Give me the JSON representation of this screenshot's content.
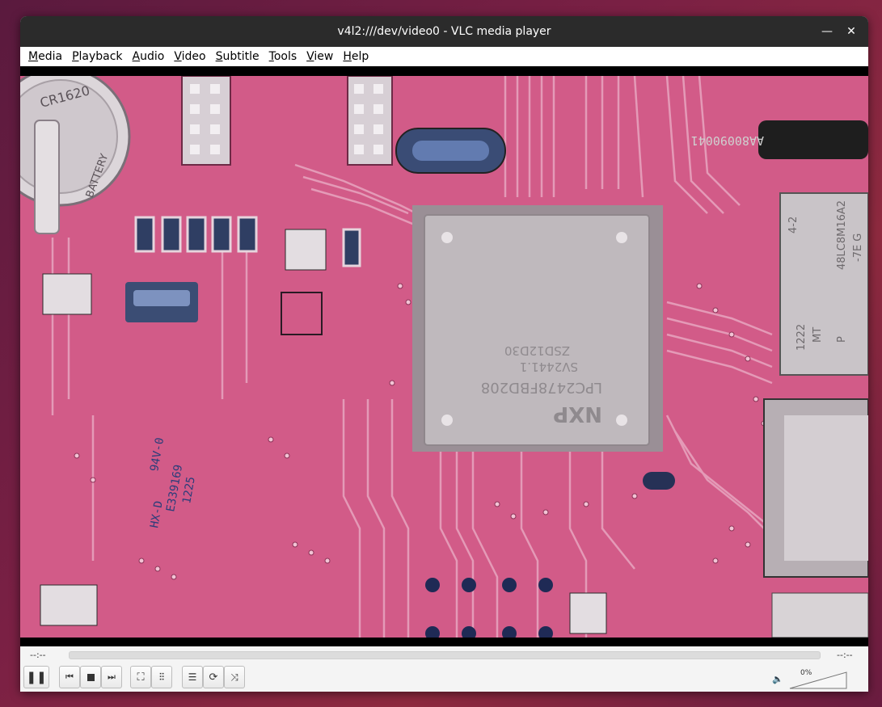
{
  "window": {
    "title": "v4l2:///dev/video0 - VLC media player"
  },
  "titlebar": {
    "minimize_icon": "minimize-icon",
    "close_icon": "close-icon"
  },
  "menu": [
    "Media",
    "Playback",
    "Audio",
    "Video",
    "Subtitle",
    "Tools",
    "View",
    "Help"
  ],
  "video": {
    "board_label": "AA80090041",
    "chip_text": [
      "LPC2478FBD208",
      "SV2441.1",
      "ZSD12D30",
      "NXP"
    ],
    "ram_text": [
      "48LC8M16A2",
      "-7E G",
      "MT",
      "1222",
      "P",
      "4-2"
    ],
    "ul_text": [
      "94V-0",
      "E339169",
      "HX-D",
      "1225"
    ],
    "battery_text": [
      "CR1620",
      "BATTERY"
    ]
  },
  "controls": {
    "elapsed": "--:--",
    "remaining": "--:--",
    "seek_progress": 0,
    "volume_label": "0%",
    "volume_level": 0,
    "buttons": [
      "pause-icon",
      "previous-icon",
      "stop-icon",
      "next-icon",
      "fullscreen-icon",
      "extended-settings-icon",
      "playlist-icon",
      "loop-icon",
      "shuffle-icon",
      "volume-muted-icon"
    ]
  }
}
